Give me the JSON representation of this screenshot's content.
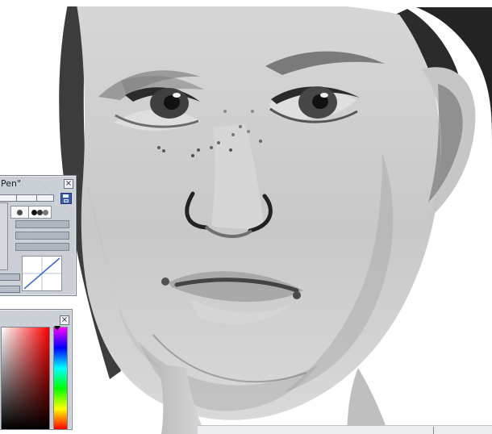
{
  "app": {
    "window_title": ""
  },
  "pen_panel": {
    "title": "Pen\"",
    "close_label": "×",
    "icons": [
      "save-icon",
      "brush-dot-icon",
      "brush-stack-icon",
      "curve-icon"
    ]
  },
  "color_panel": {
    "title": "",
    "close_label": "×",
    "selected_hue": "#ff0000",
    "field_colors": [
      "#ffffff",
      "#ff0000",
      "#000000"
    ],
    "hue_colors": [
      "#ff00ff",
      "#0000ff",
      "#00ffff",
      "#00ff00",
      "#ffff00",
      "#ff0000"
    ]
  },
  "status": {
    "bottom_bar": ""
  }
}
